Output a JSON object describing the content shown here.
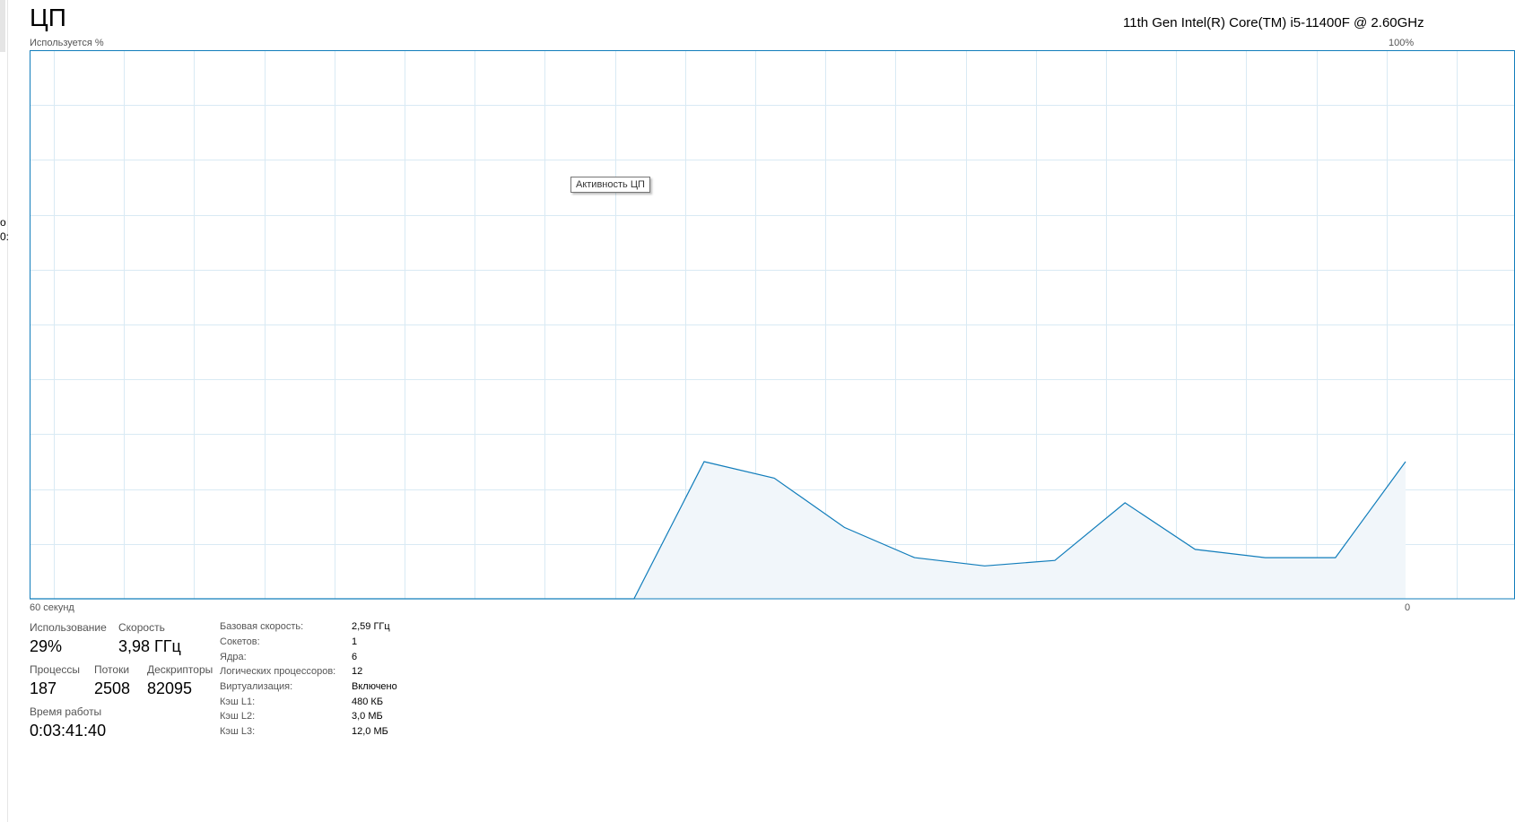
{
  "header": {
    "title": "ЦП",
    "cpu_name": "11th Gen Intel(R) Core(TM) i5-11400F @ 2.60GHz"
  },
  "sidebar_fragments": [
    "о",
    "0:"
  ],
  "chart_data": {
    "type": "area",
    "ylabel": "Используется %",
    "ymax_label": "100%",
    "xlabel_left": "60 секунд",
    "xlabel_right": "0",
    "tooltip": "Активность ЦП",
    "ylim": [
      0,
      100
    ],
    "xlim": [
      60,
      0
    ],
    "grid": true,
    "line_color": "#117dbb",
    "fill_color": "#f1f6fa",
    "grid_color": "#d9eaf4",
    "x": [
      60,
      59,
      58,
      57,
      56,
      55,
      54,
      53,
      52,
      51,
      50,
      49,
      48,
      47,
      46,
      45,
      44,
      43,
      42,
      41,
      40,
      39,
      38,
      37,
      36,
      35,
      34,
      33,
      32,
      31,
      30,
      29,
      28,
      27,
      26,
      25,
      24,
      23,
      22,
      21,
      20,
      19,
      18,
      17,
      16,
      15,
      14,
      13,
      12,
      11,
      10,
      9,
      8,
      7,
      6,
      5,
      4,
      3,
      2,
      1,
      0
    ],
    "values": [
      0,
      0,
      0,
      0,
      0,
      0,
      0,
      0,
      0,
      0,
      0,
      0,
      0,
      0,
      0,
      0,
      0,
      0,
      0,
      0,
      0,
      0,
      0,
      0,
      0,
      0,
      0,
      0,
      0,
      0,
      0,
      0,
      0,
      0,
      0,
      0,
      0,
      0,
      0,
      0,
      0,
      0,
      0,
      0,
      0,
      0,
      0,
      0,
      0,
      0,
      25,
      22,
      13,
      7.5,
      6,
      7,
      17.5,
      9,
      7.5,
      7.5,
      25
    ]
  },
  "stats": {
    "usage": {
      "label": "Использование",
      "value": "29%"
    },
    "speed": {
      "label": "Скорость",
      "value": "3,98 ГГц"
    },
    "processes": {
      "label": "Процессы",
      "value": "187"
    },
    "threads": {
      "label": "Потоки",
      "value": "2508"
    },
    "handles": {
      "label": "Дескрипторы",
      "value": "82095"
    },
    "uptime": {
      "label": "Время работы",
      "value": "0:03:41:40"
    }
  },
  "info": [
    {
      "label": "Базовая скорость:",
      "value": "2,59 ГГц"
    },
    {
      "label": "Сокетов:",
      "value": "1"
    },
    {
      "label": "Ядра:",
      "value": "6"
    },
    {
      "label": "Логических процессоров:",
      "value": "12"
    },
    {
      "label": "Виртуализация:",
      "value": "Включено"
    },
    {
      "label": "Кэш L1:",
      "value": "480 КБ"
    },
    {
      "label": "Кэш L2:",
      "value": "3,0 МБ"
    },
    {
      "label": "Кэш L3:",
      "value": "12,0 МБ"
    }
  ]
}
